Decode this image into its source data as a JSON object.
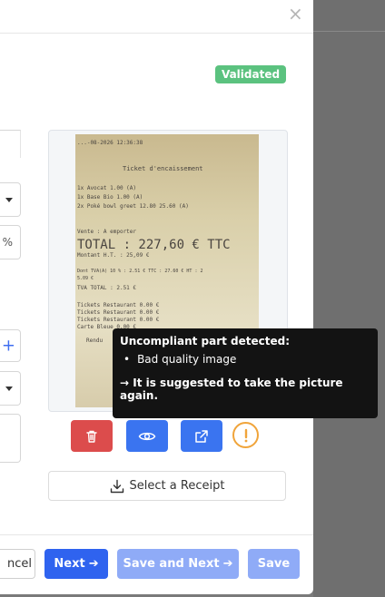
{
  "modal": {
    "close_glyph": "×",
    "status_badge": "Validated"
  },
  "fields": {
    "percent_suffix": "%",
    "add_glyph": "+"
  },
  "receipt": {
    "lines": [
      "...-08-2026  12:36:38",
      "Ticket d'encaissement",
      "1x Avocat            1.00 (A)",
      "1x Base Bio          1.00 (A)",
      "2x Poké bowl greet  12.80 25.60 (A)",
      "Vente :          A emporter",
      "TOTAL : 227,60 € TTC",
      "Montant H.T. : 25,09 €",
      "Dont TVA(A) 10 % : 2.51 € TTC : 27.60 € HT : 2",
      "5.09 €",
      "TVA TOTAL : 2.51 €",
      "Tickets Restaurant          0.00 €",
      "Tickets Restaurant          0.00 €",
      "Tickets Restaurant          0.00 €",
      "Carte Bleue                 0.00 €",
      "Rendu"
    ]
  },
  "tooltip": {
    "title": "Uncompliant part detected:",
    "item": "Bad quality image",
    "suggestion": "→ It is suggested to take the picture again."
  },
  "actions": {
    "select_receipt": "Select a Receipt"
  },
  "footer": {
    "cancel": "ncel",
    "next": "Next",
    "save_next": "Save and Next",
    "save": "Save",
    "arrow": "➔"
  },
  "colors": {
    "primary": "#2f63ef",
    "primary_disabled": "#8fabf7",
    "danger": "#dc4c4c",
    "success": "#5bc27f",
    "warning": "#f0a43a"
  },
  "icons": [
    "close-icon",
    "trash-icon",
    "eye-icon",
    "external-link-icon",
    "warning-icon",
    "download-icon",
    "arrow-right-icon",
    "chevron-down-icon",
    "plus-icon"
  ]
}
